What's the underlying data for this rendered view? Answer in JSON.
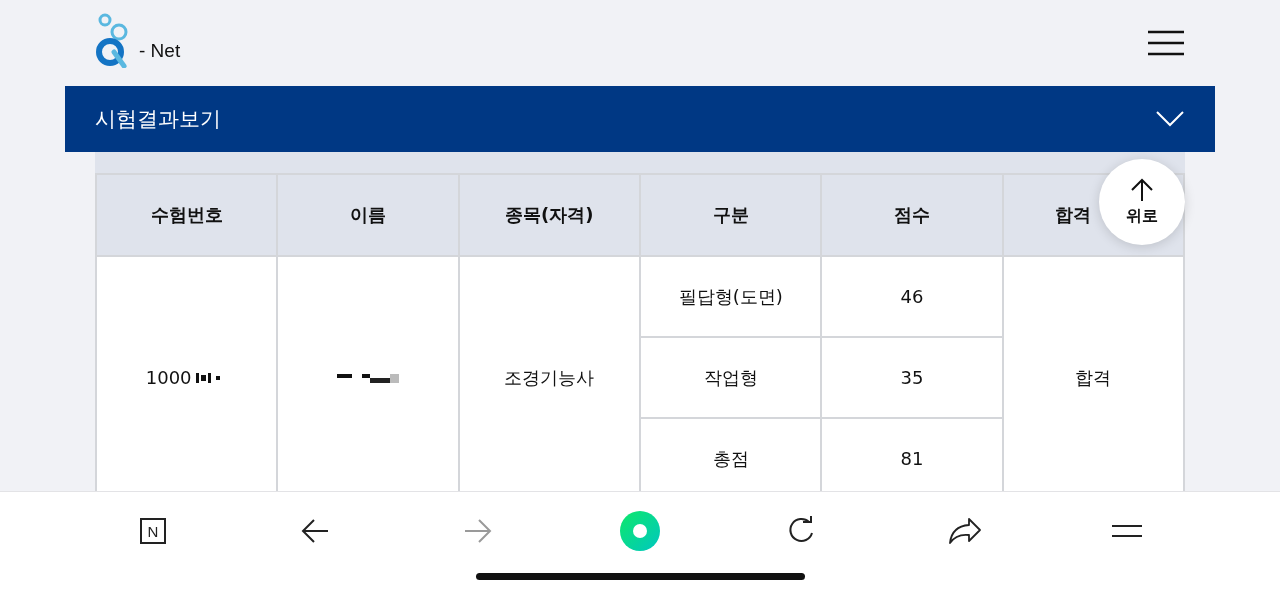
{
  "header": {
    "logo_text": "- Net"
  },
  "section_bar": {
    "title": "시험결과보기",
    "expanded": false
  },
  "table": {
    "columns": [
      "수험번호",
      "이름",
      "종목(자격)",
      "구분",
      "점수",
      "합격"
    ],
    "exam_number": "1000",
    "qualification": "조경기능사",
    "parts": [
      {
        "label": "필답형(도면)",
        "score": "46"
      },
      {
        "label": "작업형",
        "score": "35"
      },
      {
        "label": "총점",
        "score": "81"
      }
    ],
    "result": "합격"
  },
  "scroll_top_button": {
    "label": "위로"
  },
  "browser_toolbar": [
    {
      "kind": "home",
      "label": "N",
      "disabled": false
    },
    {
      "kind": "back",
      "disabled": false
    },
    {
      "kind": "forward",
      "disabled": true
    },
    {
      "kind": "search",
      "disabled": false
    },
    {
      "kind": "reload",
      "disabled": false
    },
    {
      "kind": "share",
      "disabled": false
    },
    {
      "kind": "menu",
      "disabled": false
    }
  ]
}
